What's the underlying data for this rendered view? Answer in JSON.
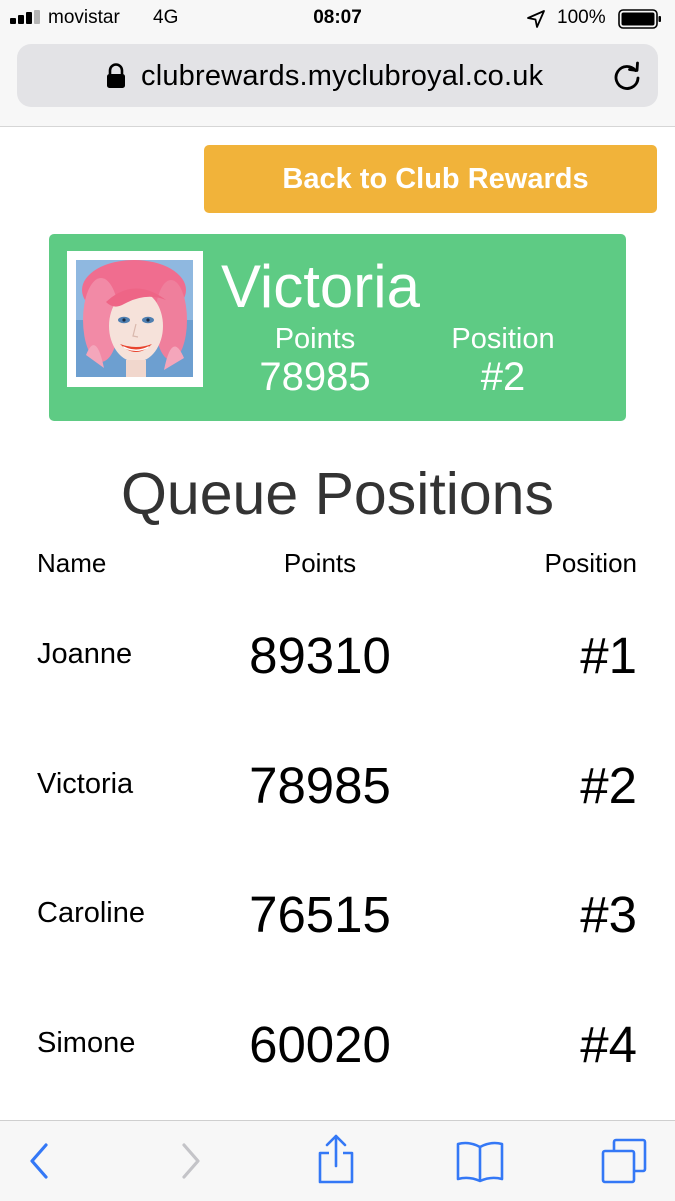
{
  "status_bar": {
    "carrier": "movistar",
    "network": "4G",
    "time": "08:07",
    "battery": "100%",
    "icons": [
      "signal-icon",
      "location-arrow-icon",
      "battery-icon"
    ]
  },
  "browser": {
    "url": "clubrewards.myclubroyal.co.uk",
    "icons": [
      "lock-icon",
      "reload-icon"
    ]
  },
  "back_button": {
    "label": "Back to Club Rewards",
    "color": "#f1b33a"
  },
  "profile": {
    "name": "Victoria",
    "points_label": "Points",
    "points": "78985",
    "position_label": "Position",
    "position": "#2",
    "card_color": "#5ecb84"
  },
  "queue": {
    "title": "Queue Positions",
    "headers": {
      "name": "Name",
      "points": "Points",
      "position": "Position"
    },
    "rows": [
      {
        "name": "Joanne",
        "points": "89310",
        "position": "#1"
      },
      {
        "name": "Victoria",
        "points": "78985",
        "position": "#2"
      },
      {
        "name": "Caroline",
        "points": "76515",
        "position": "#3"
      },
      {
        "name": "Simone",
        "points": "60020",
        "position": "#4"
      }
    ]
  },
  "toolbar": {
    "icons": [
      "back-icon",
      "forward-icon",
      "share-icon",
      "bookmarks-icon",
      "tabs-icon"
    ],
    "accent": "#3478f6"
  }
}
